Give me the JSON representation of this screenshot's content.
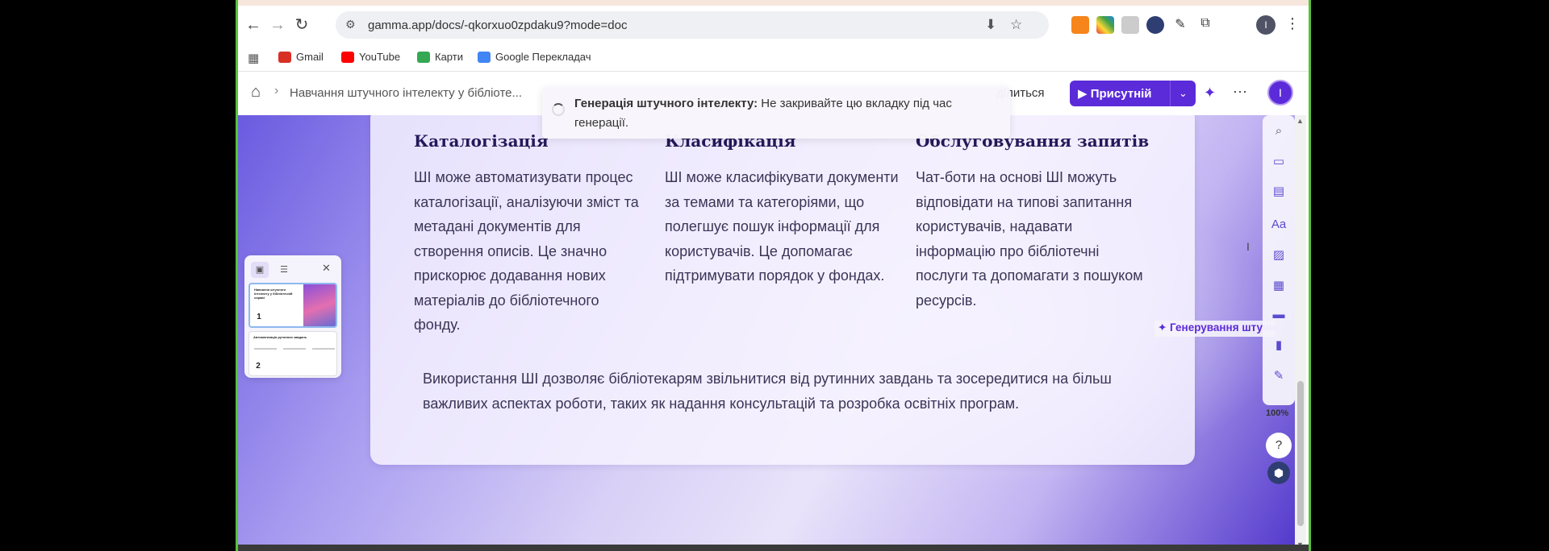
{
  "browser": {
    "url": "gamma.app/docs/-qkorxuo0zpdaku9?mode=doc",
    "back_icon": "arrow-left-icon",
    "forward_icon": "arrow-right-icon",
    "reload_icon": "reload-icon",
    "profile_initial": "I",
    "bookmarks": [
      {
        "label": "Gmail",
        "color": "#d93025"
      },
      {
        "label": "YouTube",
        "color": "#ff0000"
      },
      {
        "label": "Карти",
        "color": "#34a853"
      },
      {
        "label": "Google Перекладач",
        "color": "#4285f4"
      }
    ]
  },
  "header": {
    "breadcrumb": "Навчання штучного інтелекту у бібліоте...",
    "share_label": "ділиться",
    "present_label": "▶ Присутній",
    "avatar_initial": "I",
    "accent_color": "#5b2bd9"
  },
  "toast": {
    "strong": "Генерація штучного інтелекту:",
    "message": " Не закривайте цю вкладку під час генерації."
  },
  "card": {
    "columns": [
      {
        "title": "Каталогізація",
        "body": "ШІ може автоматизувати процес каталогізації, аналізуючи зміст та метадані документів для створення описів. Це значно прискорює додавання нових матеріалів до бібліотечного фонду."
      },
      {
        "title": "Класифікація",
        "body": "ШІ може класифікувати документи за темами та категоріями, що полегшує пошук інформації для користувачів. Це допомагає підтримувати порядок у фондах."
      },
      {
        "title": "Обслуговування запитів",
        "body": "Чат-боти на основі ШІ можуть відповідати на типові запитання користувачів, надавати інформацію про бібліотечні послуги та допомагати з пошуком ресурсів."
      }
    ],
    "summary": "Використання ШІ дозволяє бібліотекарям звільнитися від рутинних завдань та зосередитися на більш важливих аспектах роботи, таких як надання консультацій та розробка освітніх програм."
  },
  "thumbnails": {
    "items": [
      {
        "number": "1",
        "title": "Навчання штучного інтелекту у бібліотечній справі"
      },
      {
        "number": "2",
        "title": "Автоматизація рутинних завдань"
      }
    ]
  },
  "right_toolbar": {
    "zoom": "100%",
    "help": "?",
    "generate_label": "✦ Генерування штучного"
  }
}
